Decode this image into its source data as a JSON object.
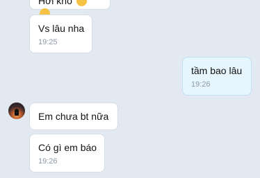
{
  "chat": {
    "messages": [
      {
        "text": "Hơi khó",
        "time": "",
        "sender": "other",
        "emoji": [
          "smile-emoji",
          "smile-emoji"
        ]
      },
      {
        "text": "Vs lâu nha",
        "time": "19:25",
        "sender": "other"
      },
      {
        "text": "tầm bao lâu",
        "time": "19:26",
        "sender": "me"
      },
      {
        "text": "Em chưa bt nữa",
        "time": "",
        "sender": "other"
      },
      {
        "text": "Có gì em báo",
        "time": "19:26",
        "sender": "other"
      }
    ]
  },
  "colors": {
    "background": "#e2e9f1",
    "incoming_bubble": "#ffffff",
    "outgoing_bubble": "#e6f5fe",
    "timestamp": "#8e99a6"
  }
}
